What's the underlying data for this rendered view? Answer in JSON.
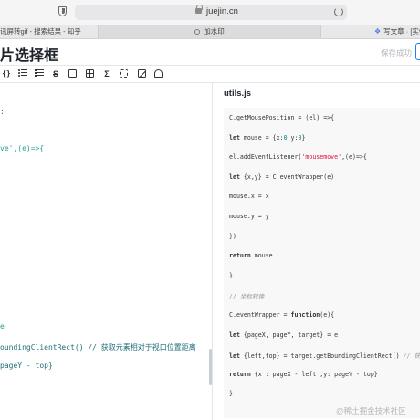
{
  "browser": {
    "url": "juejin.cn",
    "tabs": [
      {
        "label": "讯屏转gif - 搜索结果 - 知乎"
      },
      {
        "label": "加水印"
      },
      {
        "label": "写文章 · [实例"
      }
    ]
  },
  "editor": {
    "title": "片选择框",
    "save_status": "保存成功",
    "toolbar": [
      {
        "name": "code-block-icon",
        "glyph": "{}"
      },
      {
        "name": "unordered-list-icon",
        "glyph": ""
      },
      {
        "name": "ordered-list-icon",
        "glyph": ""
      },
      {
        "name": "strikethrough-icon",
        "glyph": "S"
      },
      {
        "name": "task-list-icon",
        "glyph": ""
      },
      {
        "name": "table-icon",
        "glyph": ""
      },
      {
        "name": "formula-icon",
        "glyph": "Σ"
      },
      {
        "name": "grid-icon",
        "glyph": ""
      },
      {
        "name": "image-icon",
        "glyph": ""
      },
      {
        "name": "alert-icon",
        "glyph": ""
      }
    ],
    "left_code": [
      {
        "text": ":",
        "cls": ""
      },
      {
        "text": "ve',(e)=>{",
        "cls": "ll-str"
      },
      {
        "text": "",
        "cls": ""
      },
      {
        "text": "e",
        "cls": "ll-kw"
      },
      {
        "text": "oundingClientRect() // 获取元素相对于视口位置距离",
        "cls": "ll-cmt"
      },
      {
        "text": " pageY - top}",
        "cls": "ll-cmt"
      }
    ]
  },
  "preview": {
    "file_heading": "utils.js",
    "code_lines": [
      {
        "parts": [
          {
            "t": "C.getMousePosition = (el) =>{",
            "c": ""
          }
        ]
      },
      {
        "parts": [
          {
            "t": "let",
            "c": "kw"
          },
          {
            "t": " mouse = {x:",
            "c": ""
          },
          {
            "t": "0",
            "c": "num"
          },
          {
            "t": ",y:",
            "c": ""
          },
          {
            "t": "0",
            "c": "num"
          },
          {
            "t": "}",
            "c": ""
          }
        ]
      },
      {
        "parts": [
          {
            "t": "el.addEventListener(",
            "c": ""
          },
          {
            "t": "'mousemove'",
            "c": "str"
          },
          {
            "t": ",(e)=>{",
            "c": ""
          }
        ]
      },
      {
        "parts": [
          {
            "t": "let",
            "c": "kw"
          },
          {
            "t": " {x,y} = C.eventWrapper(e)",
            "c": ""
          }
        ]
      },
      {
        "parts": [
          {
            "t": "mouse.x = x",
            "c": ""
          }
        ]
      },
      {
        "parts": [
          {
            "t": "mouse.y = y",
            "c": ""
          }
        ]
      },
      {
        "parts": [
          {
            "t": "})",
            "c": ""
          }
        ]
      },
      {
        "parts": [
          {
            "t": "return",
            "c": "kw"
          },
          {
            "t": " mouse",
            "c": ""
          }
        ]
      },
      {
        "parts": [
          {
            "t": "}",
            "c": ""
          }
        ]
      },
      {
        "parts": [
          {
            "t": "// 坐标转换",
            "c": "cmt"
          }
        ]
      },
      {
        "parts": [
          {
            "t": "C.eventWrapper = ",
            "c": ""
          },
          {
            "t": "function",
            "c": "kw"
          },
          {
            "t": "(e){",
            "c": ""
          }
        ]
      },
      {
        "parts": [
          {
            "t": "let",
            "c": "kw"
          },
          {
            "t": " {pageX, pageY, target} = e",
            "c": ""
          }
        ]
      },
      {
        "parts": [
          {
            "t": "let",
            "c": "kw"
          },
          {
            "t": " {left,top} = target.getBoundingClientRect() ",
            "c": ""
          },
          {
            "t": "// 获取元素",
            "c": "cmt"
          }
        ]
      },
      {
        "parts": [
          {
            "t": "return",
            "c": "kw"
          },
          {
            "t": " {x : pageX - left ,y: pageY - top}",
            "c": ""
          }
        ]
      },
      {
        "parts": [
          {
            "t": "}",
            "c": ""
          }
        ]
      }
    ]
  },
  "watermark": "@稀土掘金技术社区"
}
